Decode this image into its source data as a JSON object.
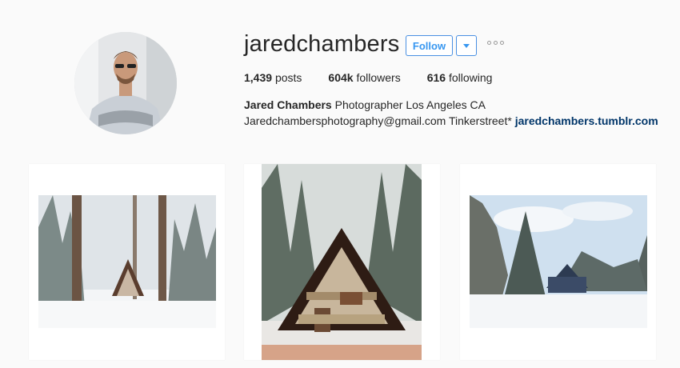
{
  "profile": {
    "username": "jaredchambers",
    "follow_label": "Follow",
    "icons": {
      "dropdown": "chevron-down-icon",
      "more": "more-options-icon"
    },
    "stats": {
      "posts_count": "1,439",
      "posts_label": "posts",
      "followers_count": "604k",
      "followers_label": "followers",
      "following_count": "616",
      "following_label": "following"
    },
    "bio": {
      "full_name": "Jared Chambers",
      "description": "Photographer Los Angeles CA",
      "contact": "Jaredchambersphotography@gmail.com Tinkerstreet*",
      "website": "jaredchambers.tumblr.com"
    }
  },
  "colors": {
    "accent": "#3897f0",
    "link": "#003569",
    "background": "#fafafa"
  }
}
